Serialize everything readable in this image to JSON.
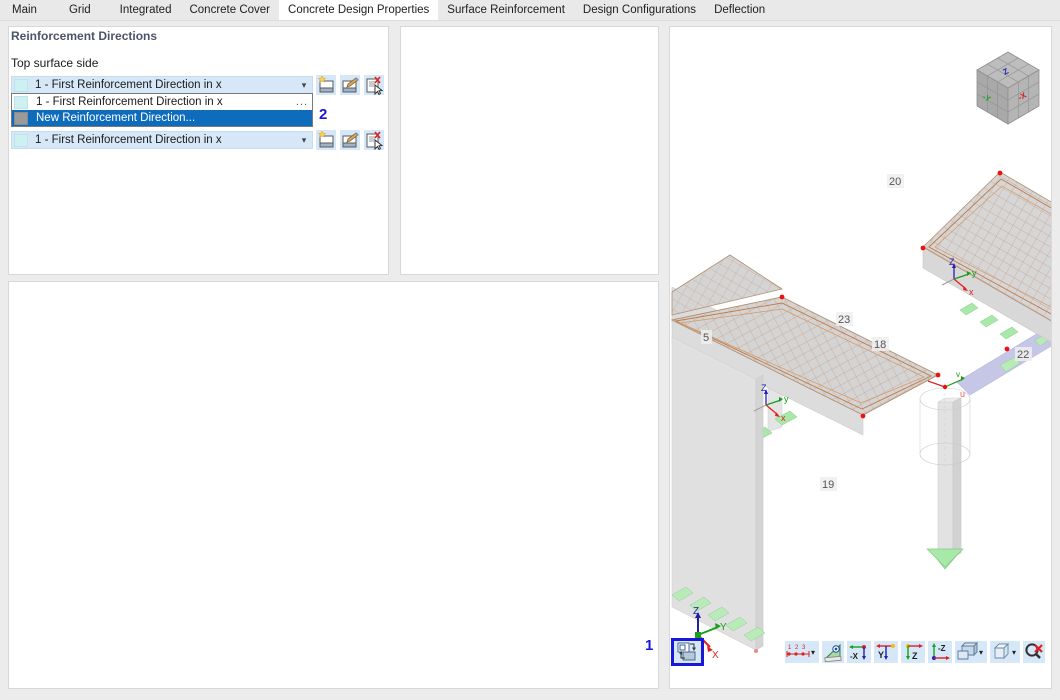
{
  "tabs": [
    {
      "label": "Main",
      "active": false
    },
    {
      "label": "Grid",
      "active": false
    },
    {
      "label": "Integrated",
      "active": false
    },
    {
      "label": "Concrete Cover",
      "active": false
    },
    {
      "label": "Concrete Design Properties",
      "active": true
    },
    {
      "label": "Surface Reinforcement",
      "active": false
    },
    {
      "label": "Design Configurations",
      "active": false
    },
    {
      "label": "Deflection",
      "active": false
    }
  ],
  "reinforcement_panel": {
    "title": "Reinforcement Directions",
    "sublabel": "Top surface side",
    "combo_top_value": "1 - First Reinforcement Direction in x",
    "combo_bottom_value": "1 - First Reinforcement Direction in x",
    "dropdown_items": [
      {
        "label": "1 - First Reinforcement Direction in x",
        "selected": false,
        "dots": "..."
      },
      {
        "label": "New Reinforcement Direction...",
        "selected": true,
        "dots": ""
      }
    ],
    "buttons": {
      "new": "new-reinforcement-direction",
      "edit": "edit-reinforcement-direction",
      "delete": "delete-reinforcement-direction"
    }
  },
  "annotations": {
    "marker_1": "1",
    "marker_2": "2"
  },
  "viewport": {
    "member_labels": [
      "20",
      "23",
      "5",
      "18",
      "22",
      "19"
    ],
    "local_axis_label": "u",
    "nav_cube_faces": {
      "top": "Z",
      "left": "-Y",
      "right": "-X"
    },
    "global_axes": [
      "Z",
      "Y",
      "X"
    ],
    "colors": {
      "axis_x": "#e02020",
      "axis_y": "#18a018",
      "axis_z": "#2020c0",
      "reinforcement_mesh": "#c08060",
      "support_green": "#a8e8a8",
      "member_beam": "#c0c0e8",
      "node_red": "#ee1010",
      "slab_fill": "#d4d4d4"
    }
  },
  "toolbar": {
    "highlight_button": "render-display-properties",
    "items": [
      {
        "name": "numbering-display",
        "caret": true
      },
      {
        "name": "view-angle-ruler",
        "caret": false
      },
      {
        "name": "view-direction-minus-x",
        "caret": false
      },
      {
        "name": "view-direction-y",
        "caret": false
      },
      {
        "name": "view-direction-z",
        "caret": false
      },
      {
        "name": "view-direction-minus-z",
        "caret": false
      },
      {
        "name": "render-mode",
        "caret": true
      },
      {
        "name": "display-model-box",
        "caret": true
      },
      {
        "name": "clear-selection",
        "caret": false
      }
    ]
  }
}
